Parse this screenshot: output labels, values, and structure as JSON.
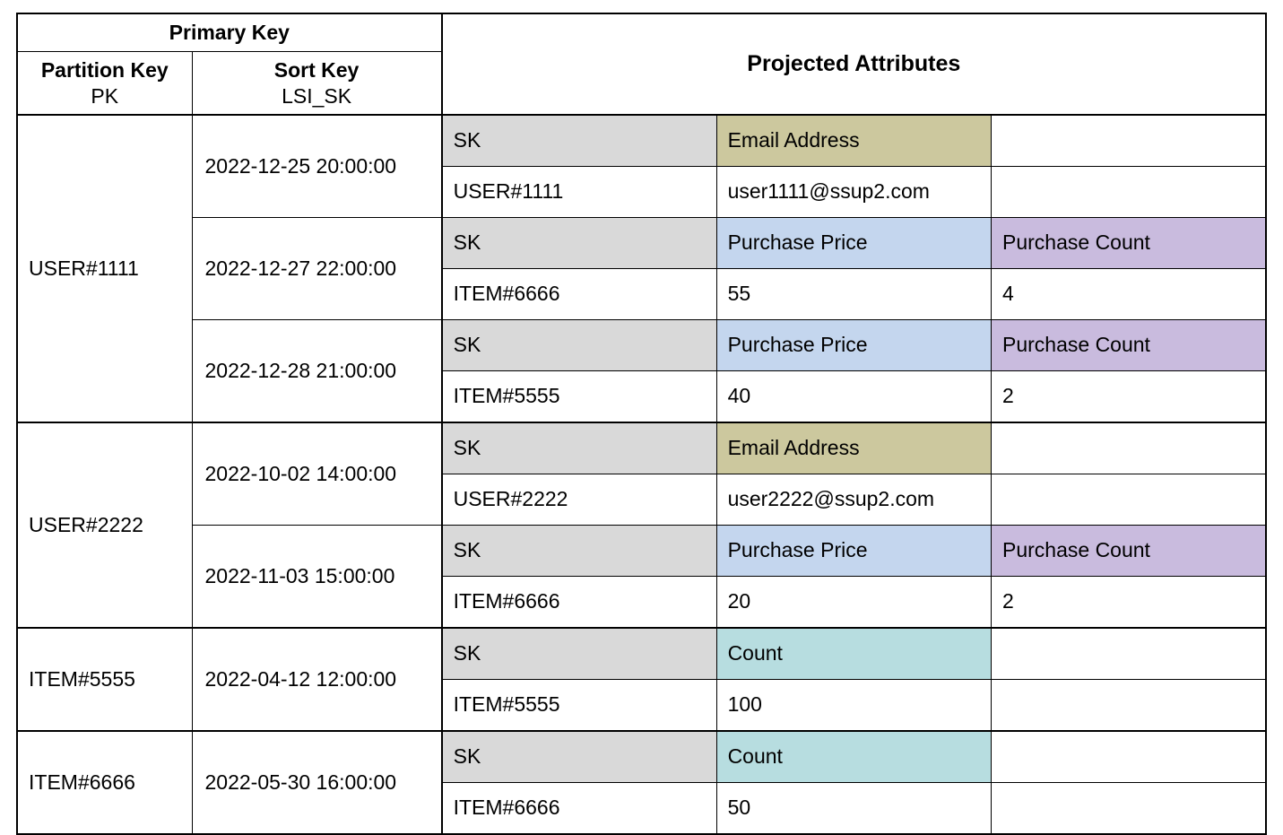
{
  "header": {
    "primary_key": "Primary Key",
    "partition_key_title": "Partition Key",
    "partition_key_sub": "PK",
    "sort_key_title": "Sort Key",
    "sort_key_sub": "LSI_SK",
    "projected_attributes": "Projected Attributes"
  },
  "labels": {
    "sk": "SK",
    "email": "Email Address",
    "price": "Purchase Price",
    "pcount": "Purchase Count",
    "count": "Count"
  },
  "groups": [
    {
      "pk": "USER#1111",
      "rows": [
        {
          "sort": "2022-12-25 20:00:00",
          "attrs_header": [
            "sk",
            "email",
            ""
          ],
          "attrs_value": [
            "USER#1111",
            "user1111@ssup2.com",
            ""
          ]
        },
        {
          "sort": "2022-12-27 22:00:00",
          "attrs_header": [
            "sk",
            "price",
            "pcount"
          ],
          "attrs_value": [
            "ITEM#6666",
            "55",
            "4"
          ]
        },
        {
          "sort": "2022-12-28 21:00:00",
          "attrs_header": [
            "sk",
            "price",
            "pcount"
          ],
          "attrs_value": [
            "ITEM#5555",
            "40",
            "2"
          ]
        }
      ]
    },
    {
      "pk": "USER#2222",
      "rows": [
        {
          "sort": "2022-10-02 14:00:00",
          "attrs_header": [
            "sk",
            "email",
            ""
          ],
          "attrs_value": [
            "USER#2222",
            "user2222@ssup2.com",
            ""
          ]
        },
        {
          "sort": "2022-11-03 15:00:00",
          "attrs_header": [
            "sk",
            "price",
            "pcount"
          ],
          "attrs_value": [
            "ITEM#6666",
            "20",
            "2"
          ]
        }
      ]
    },
    {
      "pk": "ITEM#5555",
      "rows": [
        {
          "sort": "2022-04-12 12:00:00",
          "attrs_header": [
            "sk",
            "count",
            ""
          ],
          "attrs_value": [
            "ITEM#5555",
            "100",
            ""
          ]
        }
      ]
    },
    {
      "pk": "ITEM#6666",
      "rows": [
        {
          "sort": "2022-05-30 16:00:00",
          "attrs_header": [
            "sk",
            "count",
            ""
          ],
          "attrs_value": [
            "ITEM#6666",
            "50",
            ""
          ]
        }
      ]
    }
  ],
  "fill_map": {
    "sk": "fill-sk",
    "email": "fill-email",
    "price": "fill-price",
    "pcount": "fill-pcount",
    "count": "fill-count",
    "": ""
  }
}
